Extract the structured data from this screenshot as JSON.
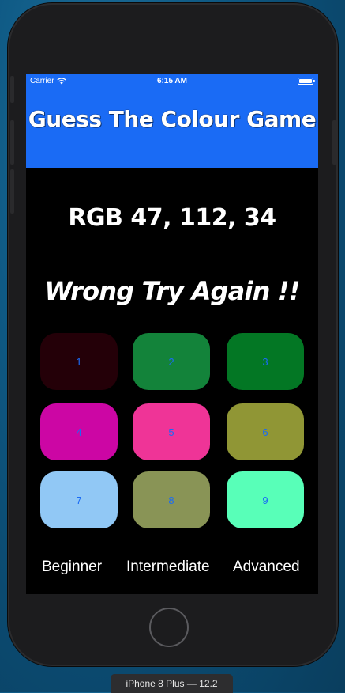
{
  "status_bar": {
    "carrier": "Carrier",
    "time": "6:15 AM"
  },
  "nav": {
    "title": "Guess The Colour Game",
    "color": "#1a6bf5"
  },
  "game": {
    "rgb_prompt": "RGB 47, 112, 34",
    "result": "Wrong Try Again !!"
  },
  "tiles": [
    {
      "label": "1",
      "color": "#240008"
    },
    {
      "label": "2",
      "color": "#13833a"
    },
    {
      "label": "3",
      "color": "#037724"
    },
    {
      "label": "4",
      "color": "#cc06a4"
    },
    {
      "label": "5",
      "color": "#ef3497"
    },
    {
      "label": "6",
      "color": "#909635"
    },
    {
      "label": "7",
      "color": "#91c8f5"
    },
    {
      "label": "8",
      "color": "#899456"
    },
    {
      "label": "9",
      "color": "#58ffb8"
    }
  ],
  "levels": {
    "beginner": "Beginner",
    "intermediate": "Intermediate",
    "advanced": "Advanced"
  },
  "simulator_label": "iPhone 8 Plus — 12.2"
}
